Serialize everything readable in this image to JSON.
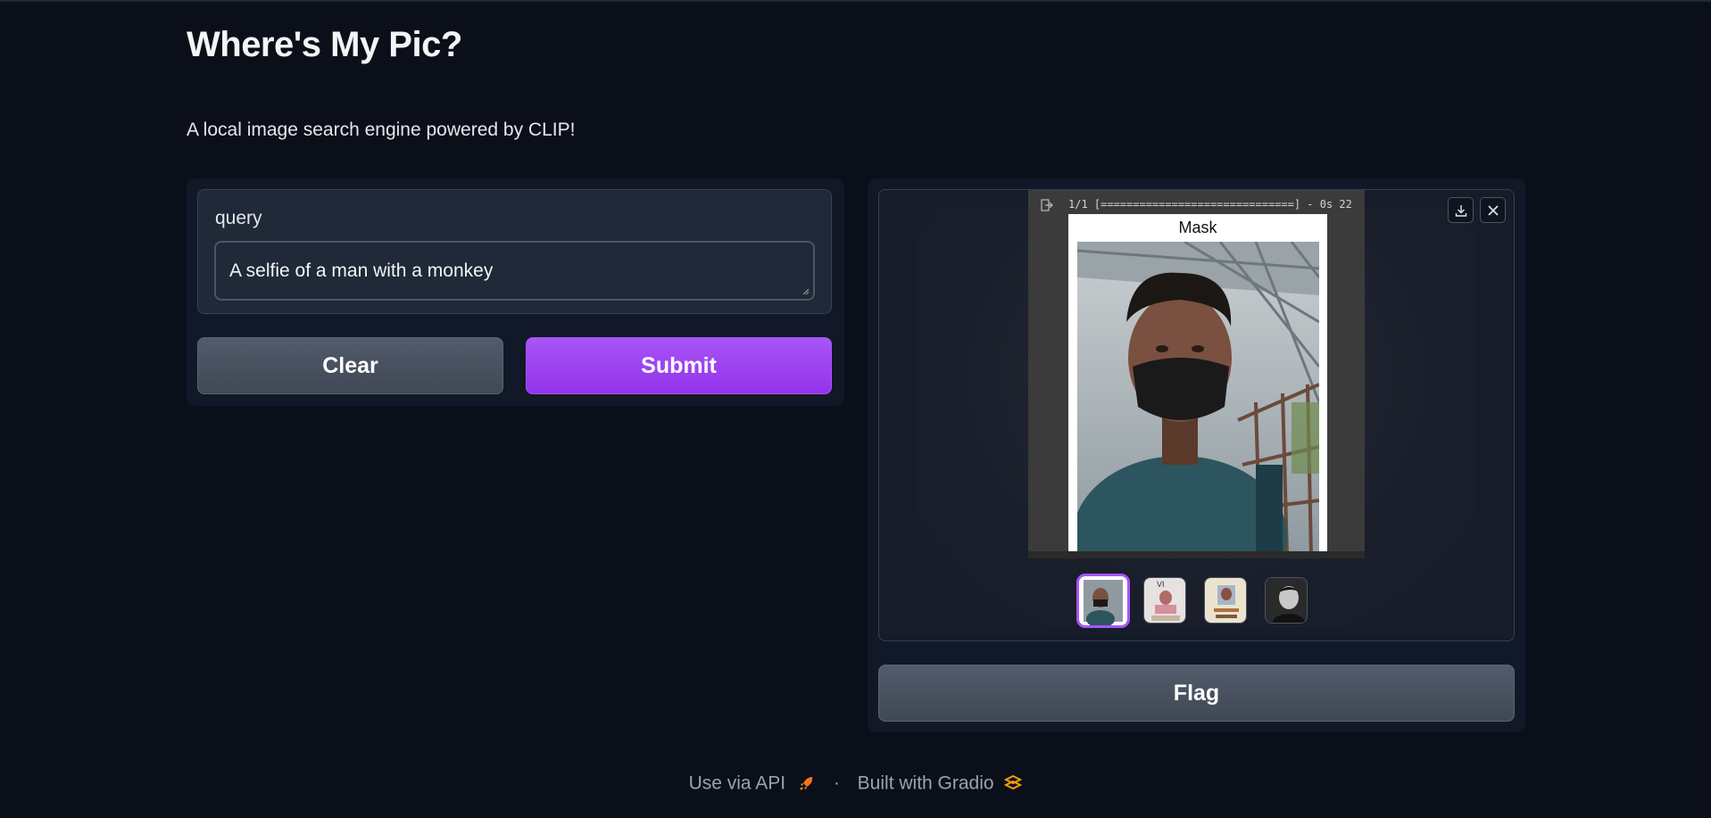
{
  "app": {
    "title": "Where's My Pic?",
    "description": "A local image search engine powered by CLIP!"
  },
  "form": {
    "query_label": "query",
    "query_value": "A selfie of a man with a monkey",
    "clear_label": "Clear",
    "submit_label": "Submit"
  },
  "gallery": {
    "preview_progress_text": "1/1 [==============================] - 0s 22",
    "preview_figure_title": "Mask",
    "thumbnail_count": 4,
    "selected_index": 0,
    "thumbnails": [
      {
        "label": ""
      },
      {
        "label": "VI"
      },
      {
        "label": ""
      },
      {
        "label": ""
      }
    ]
  },
  "flag_label": "Flag",
  "footer": {
    "api_label": "Use via API",
    "separator": "·",
    "built_label": "Built with Gradio"
  },
  "colors": {
    "background": "#0b0f19",
    "panel": "#111827",
    "accent": "#a855f7",
    "button_secondary": "#4b5563"
  },
  "icons": [
    "exit-icon",
    "download-icon",
    "close-icon",
    "rocket-icon",
    "gradio-logo-icon"
  ]
}
